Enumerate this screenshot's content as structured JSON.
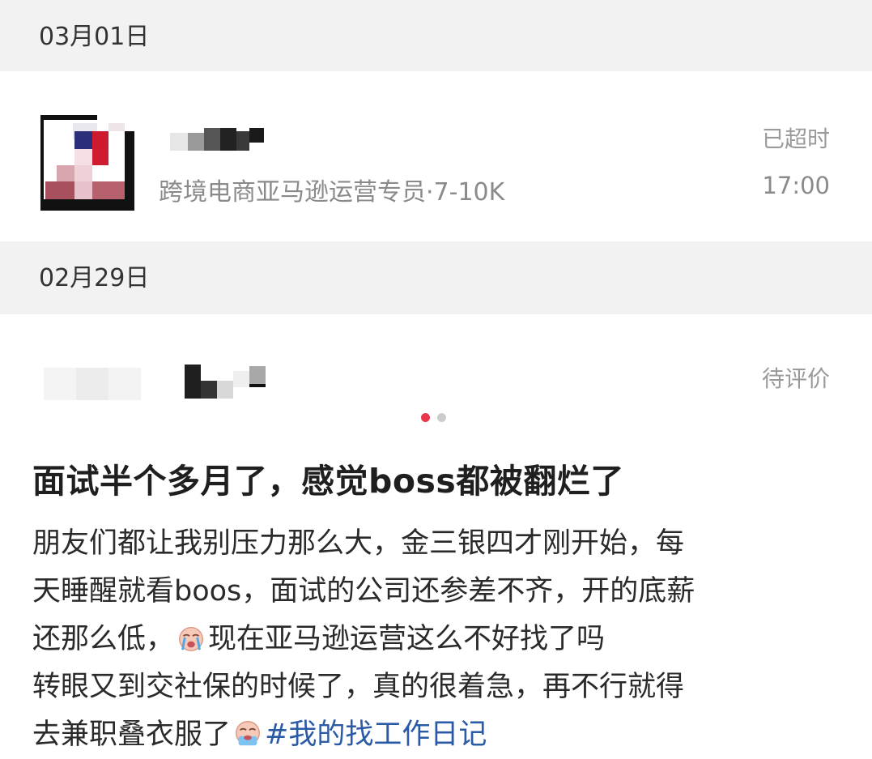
{
  "sections": [
    {
      "date": "03月01日",
      "item": {
        "subtitle": "跨境电商亚马逊运营专员·7-10K",
        "status": "已超时",
        "time": "17:00"
      }
    },
    {
      "date": "02月29日",
      "item": {
        "status": "待评价"
      }
    }
  ],
  "pager": {
    "active_index": 0,
    "total": 2,
    "active_color": "#e8364a",
    "inactive_color": "#cccccc"
  },
  "post": {
    "title": "面试半个多月了，感觉boss都被翻烂了",
    "lines": [
      "朋友们都让我别压力那么大，金三银四才刚开始，每",
      "天睡醒就看boos，面试的公司还参差不齐，开的底薪",
      "还那么低，",
      "现在亚马逊运营这么不好找了吗",
      "转眼又到交社保的时候了，真的很着急，再不行就得",
      "去兼职叠衣服了",
      "#我的找工作日记"
    ],
    "emojis": [
      "crying-face-icon",
      "crying-face-icon"
    ]
  }
}
